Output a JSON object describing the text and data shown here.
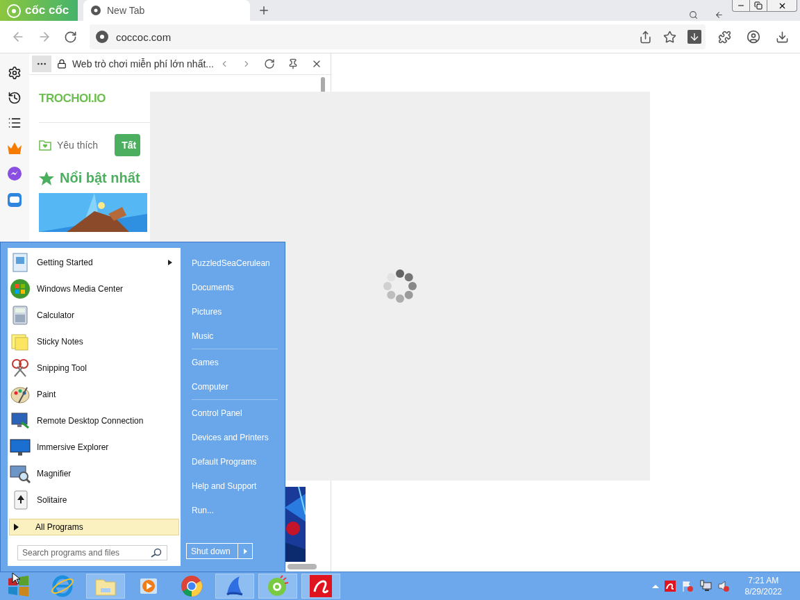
{
  "browser": {
    "brand": "cốc cốc",
    "tabs": [
      {
        "label": "New Tab",
        "selected": true
      }
    ],
    "address": "coccoc.com"
  },
  "side_panel": {
    "title": "Web trò chơi miễn phí lớn nhất...",
    "site_logo": "TROCHOI.IO",
    "filters": [
      {
        "label": "Yêu thích",
        "selected": false
      },
      {
        "label": "Tất",
        "selected": true
      }
    ],
    "section_title": "Nổi bật nhất"
  },
  "start_menu": {
    "programs": [
      {
        "label": "Getting Started",
        "submenu": true
      },
      {
        "label": "Windows Media Center",
        "submenu": false
      },
      {
        "label": "Calculator",
        "submenu": false
      },
      {
        "label": "Sticky Notes",
        "submenu": false
      },
      {
        "label": "Snipping Tool",
        "submenu": false
      },
      {
        "label": "Paint",
        "submenu": false
      },
      {
        "label": "Remote Desktop Connection",
        "submenu": false
      },
      {
        "label": "Immersive Explorer",
        "submenu": false
      },
      {
        "label": "Magnifier",
        "submenu": false
      },
      {
        "label": "Solitaire",
        "submenu": false
      }
    ],
    "all_programs": "All Programs",
    "search": {
      "placeholder": "Search programs and files"
    },
    "place_groups": [
      [
        "PuzzledSeaCerulean",
        "Documents",
        "Pictures",
        "Music"
      ],
      [
        "Games",
        "Computer"
      ],
      [
        "Control Panel",
        "Devices and Printers",
        "Default Programs",
        "Help and Support",
        "Run..."
      ]
    ],
    "shutdown": "Shut down"
  },
  "taskbar": {
    "apps": [
      {
        "running": false
      },
      {
        "running": true
      },
      {
        "running": false
      },
      {
        "running": false
      },
      {
        "running": true
      },
      {
        "running": true
      },
      {
        "running": true
      }
    ],
    "clock": {
      "time": "7:21 AM",
      "date": "8/29/2022"
    }
  }
}
